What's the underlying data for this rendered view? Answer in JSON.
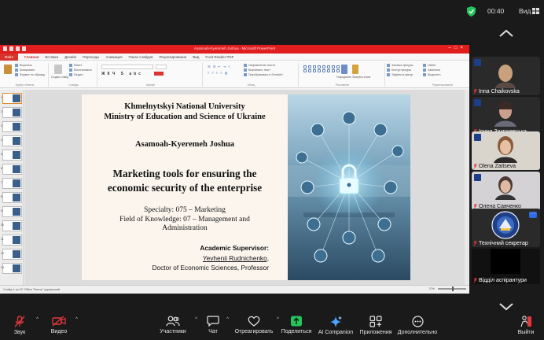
{
  "topbar": {
    "time": "00:40",
    "view_label": "Вид"
  },
  "ppt": {
    "window_title": "Asamoah-Kyeremeh Joshua - Microsoft PowerPoint",
    "tabs": [
      "Файл",
      "Главная",
      "Вставка",
      "Дизайн",
      "Переходы",
      "Анимация",
      "Показ слайдов",
      "Рецензирование",
      "Вид",
      "Foxit Reader PDF"
    ],
    "ribbon": {
      "clipboard": [
        "Вырезать",
        "Копировать",
        "Формат по образцу"
      ],
      "clipboard_label": "Буфер обмена",
      "slides_new": "Создать слайд",
      "slides_items": [
        "Макет",
        "Восстановить",
        "Раздел"
      ],
      "slides_label": "Слайды",
      "font_label": "Шрифт",
      "paragraph_label": "Абзац",
      "paragraph_items": [
        "Направление текста",
        "Выровнять текст",
        "Преобразовать в SmartArt"
      ],
      "drawing_items": [
        "Упорядочить",
        "Экспресс-стили"
      ],
      "drawing_side": [
        "Заливка фигуры",
        "Контур фигуры",
        "Эффекты фигур"
      ],
      "drawing_label": "Рисование",
      "editing_items": [
        "Найти",
        "Заменить",
        "Выделить"
      ],
      "editing_label": "Редактирование"
    },
    "status_left": "Слайд 1 из 20   \"Office Theme\"   украинский",
    "zoom": "70%"
  },
  "slide": {
    "university": "Khmelnytskyi National University",
    "ministry": "Ministry of Education and Science of Ukraine",
    "author": "Asamoah-Kyeremeh Joshua",
    "title_line1": "Marketing tools for ensuring the",
    "title_line2": "economic security of the enterprise",
    "specialty": "Specialty: 075 – Marketing",
    "field_line1": "Field of Knowledge: 07 – Management and",
    "field_line2": "Administration",
    "supervisor_label": "Academic Supervisor:",
    "supervisor_name": "Yevhenii Rudnichenko,",
    "supervisor_title": "Doctor of Economic Sciences, Professor"
  },
  "participants": [
    {
      "name": "Inna Chaikovska"
    },
    {
      "name": "Ірина Закржевська"
    },
    {
      "name": "Olena Zaitseva"
    },
    {
      "name": "Олена Савченко"
    },
    {
      "name": "Технічний секретар"
    },
    {
      "name": "Відділ аспірантури"
    }
  ],
  "toolbar": {
    "audio": "Звук",
    "video": "Видео",
    "participants": "Участники",
    "participants_count": "10",
    "chat": "Чат",
    "react": "Отреагировать",
    "share": "Поделиться",
    "ai": "AI Companion",
    "apps": "Приложения",
    "more": "Дополнительно",
    "leave": "Выйти"
  },
  "colors": {
    "share_green": "#22c55e",
    "ai_blue": "#4aa3ff",
    "muted_red": "#e5383b",
    "ppt_red": "#e01e1e"
  }
}
